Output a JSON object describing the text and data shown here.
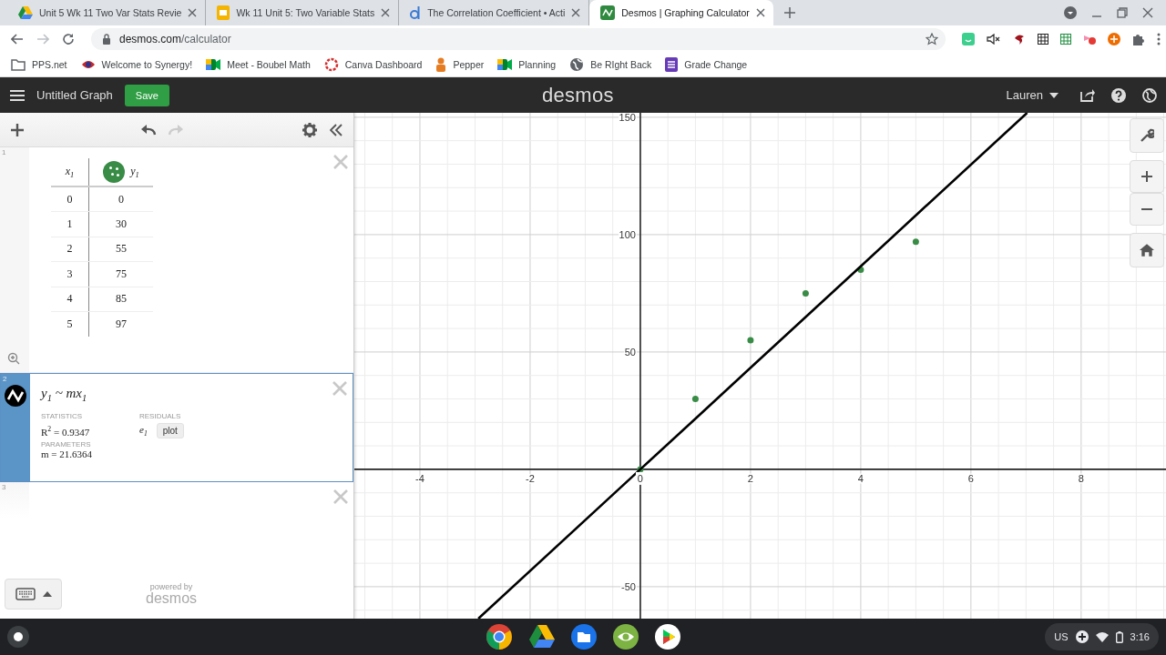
{
  "browser": {
    "tabs": [
      {
        "title": "Unit 5 Wk 11 Two Var Stats Revie",
        "selected": false
      },
      {
        "title": "Wk 11 Unit 5: Two Variable Stats",
        "selected": false
      },
      {
        "title": "The Correlation Coefficient • Acti",
        "selected": false
      },
      {
        "title": "Desmos | Graphing Calculator",
        "selected": true
      }
    ],
    "url_host": "desmos.com",
    "url_path": "/calculator",
    "bookmarks": [
      {
        "label": "PPS.net"
      },
      {
        "label": "Welcome to Synergy!"
      },
      {
        "label": "Meet - Boubel Math"
      },
      {
        "label": "Canva Dashboard"
      },
      {
        "label": "Pepper"
      },
      {
        "label": "Planning"
      },
      {
        "label": "Be RIght Back"
      },
      {
        "label": "Grade Change"
      }
    ]
  },
  "header": {
    "title": "Untitled Graph",
    "save_button": "Save",
    "logo": "desmos",
    "user": "Lauren"
  },
  "expressions": [
    {
      "kind": "table",
      "number": "1",
      "selected": false,
      "columns": [
        {
          "label": "x$_{1}$"
        },
        {
          "label": "y$_{1}$",
          "color": "#388c46"
        }
      ],
      "rows": [
        [
          "0",
          "0"
        ],
        [
          "1",
          "30"
        ],
        [
          "2",
          "55"
        ],
        [
          "3",
          "75"
        ],
        [
          "4",
          "85"
        ],
        [
          "5",
          "97"
        ]
      ]
    },
    {
      "kind": "regression",
      "number": "2",
      "selected": true,
      "formula": "y$_{1}$ ~ mx$_{1}$",
      "statistics_label": "STATISTICS",
      "statistic": "R$^{2}$ = 0.9347",
      "residuals_label": "RESIDUALS",
      "residual_variable": "e$_{1}$",
      "plot_button": "plot",
      "parameters_label": "PARAMETERS",
      "parameter": "m = 21.6364"
    },
    {
      "kind": "empty",
      "number": "3",
      "selected": false
    }
  ],
  "powered_by": {
    "caption": "powered by",
    "logo": "desmos"
  },
  "graph": {
    "chart_data": {
      "type": "scatter",
      "x": [
        -2.94,
        0,
        1,
        2,
        3,
        4,
        5,
        7.02
      ],
      "xlim": [
        -5.19,
        9.54
      ],
      "ylim": [
        -63.6,
        151.9
      ],
      "xticks": [
        -4,
        -2,
        0,
        2,
        4,
        6,
        8
      ],
      "yticks": [
        -50,
        50,
        100,
        150
      ],
      "grid": true,
      "series": [
        {
          "color": "#388c46",
          "values": [
            null,
            0,
            30,
            55,
            75,
            85,
            97,
            null
          ]
        },
        {
          "type": "line",
          "color": "#000000",
          "values": [
            -63.6,
            0,
            21.6,
            43.3,
            64.9,
            86.5,
            108.2,
            151.9
          ]
        }
      ]
    }
  },
  "taskbar": {
    "locale": "US",
    "time": "3:16"
  }
}
